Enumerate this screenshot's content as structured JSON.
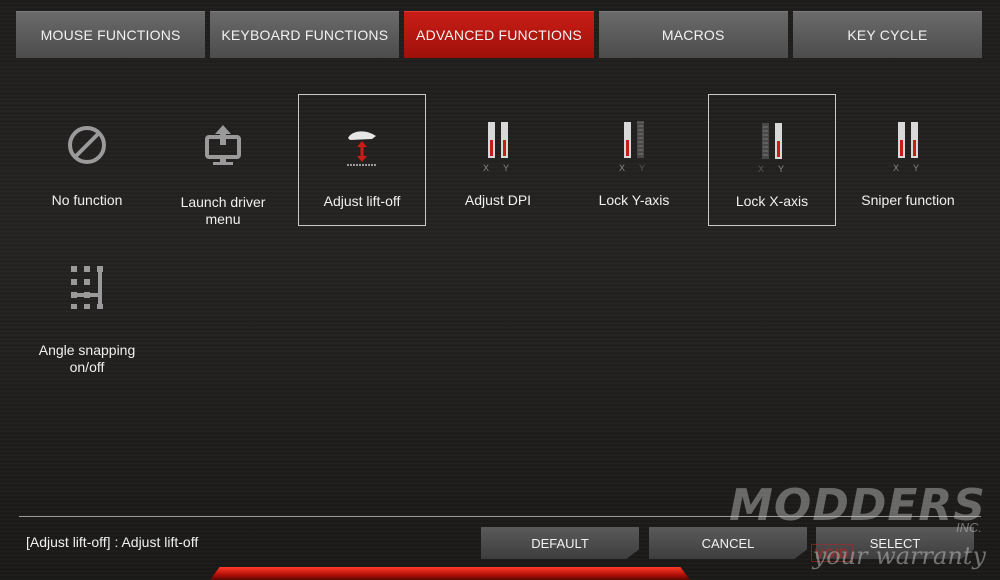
{
  "tabs": [
    {
      "label": "MOUSE FUNCTIONS"
    },
    {
      "label": "KEYBOARD FUNCTIONS"
    },
    {
      "label": "ADVANCED FUNCTIONS"
    },
    {
      "label": "MACROS"
    },
    {
      "label": "KEY CYCLE"
    }
  ],
  "functions": [
    {
      "label": "No function",
      "icon": "no-function-icon"
    },
    {
      "label": "Launch driver menu",
      "icon": "launch-driver-icon"
    },
    {
      "label": "Adjust lift-off",
      "icon": "lift-off-icon"
    },
    {
      "label": "Adjust DPI",
      "icon": "dpi-bars-icon",
      "axis_x": "X",
      "axis_y": "Y"
    },
    {
      "label": "Lock Y-axis",
      "icon": "lock-y-icon",
      "axis_x": "X",
      "axis_y": "Y"
    },
    {
      "label": "Lock X-axis",
      "icon": "lock-x-icon",
      "axis_x": "X",
      "axis_y": "Y"
    },
    {
      "label": "Sniper function",
      "icon": "sniper-icon",
      "axis_x": "X",
      "axis_y": "Y"
    },
    {
      "label": "Angle snapping on/off",
      "icon": "angle-snapping-icon"
    }
  ],
  "status_text": "[Adjust lift-off] : Adjust lift-off",
  "buttons": {
    "default": "DEFAULT",
    "cancel": "CANCEL",
    "select": "SELECT"
  },
  "watermark": {
    "brand": "MODDERS",
    "inc": "INC.",
    "void": "VOID",
    "tagline": "your warranty"
  },
  "colors": {
    "accent": "#c81d16",
    "tab": "#555555",
    "background": "#222120"
  }
}
